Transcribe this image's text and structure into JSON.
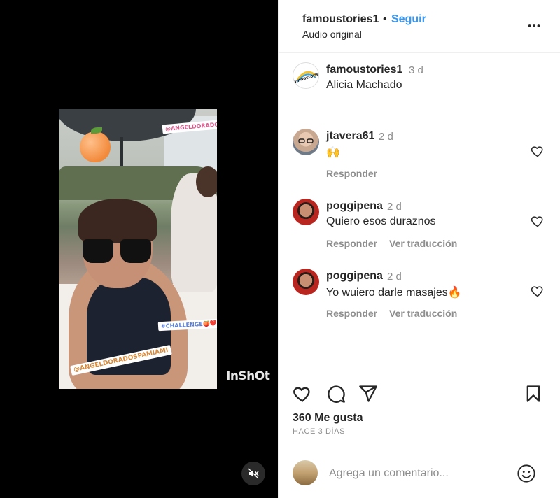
{
  "post": {
    "username": "famoustories1",
    "separator": "•",
    "follow_label": "Seguir",
    "audio": "Audio original",
    "caption_time": "3 d",
    "caption": "Alicia Machado",
    "avatar_logo_text": "famoustories"
  },
  "media": {
    "stickers": [
      "@ANGELDORADOSPA",
      "#CHALLENGE🍑❤️",
      "@ANGELDORADOSPAMIAMI"
    ],
    "watermark": "InShOt",
    "mute_icon": "speaker-muted-icon"
  },
  "comments": [
    {
      "username": "jtavera61",
      "time": "2 d",
      "text": "🙌",
      "reply_label": "Responder",
      "translate_label": ""
    },
    {
      "username": "poggipena",
      "time": "2 d",
      "text": "Quiero esos duraznos",
      "reply_label": "Responder",
      "translate_label": "Ver traducción"
    },
    {
      "username": "poggipena",
      "time": "2 d",
      "text": "Yo wuiero darle masajes🔥",
      "reply_label": "Responder",
      "translate_label": "Ver traducción"
    }
  ],
  "actions": {
    "icons": [
      "heart-icon",
      "comment-icon",
      "share-icon",
      "bookmark-icon"
    ],
    "likes": "360 Me gusta",
    "date": "HACE 3 DÍAS"
  },
  "composer": {
    "placeholder": "Agrega un comentario...",
    "emoji_icon": "smiley-icon"
  },
  "colors": {
    "link": "#3897f0",
    "text": "#262626",
    "muted": "#8e8e8e",
    "border": "#efefef"
  }
}
